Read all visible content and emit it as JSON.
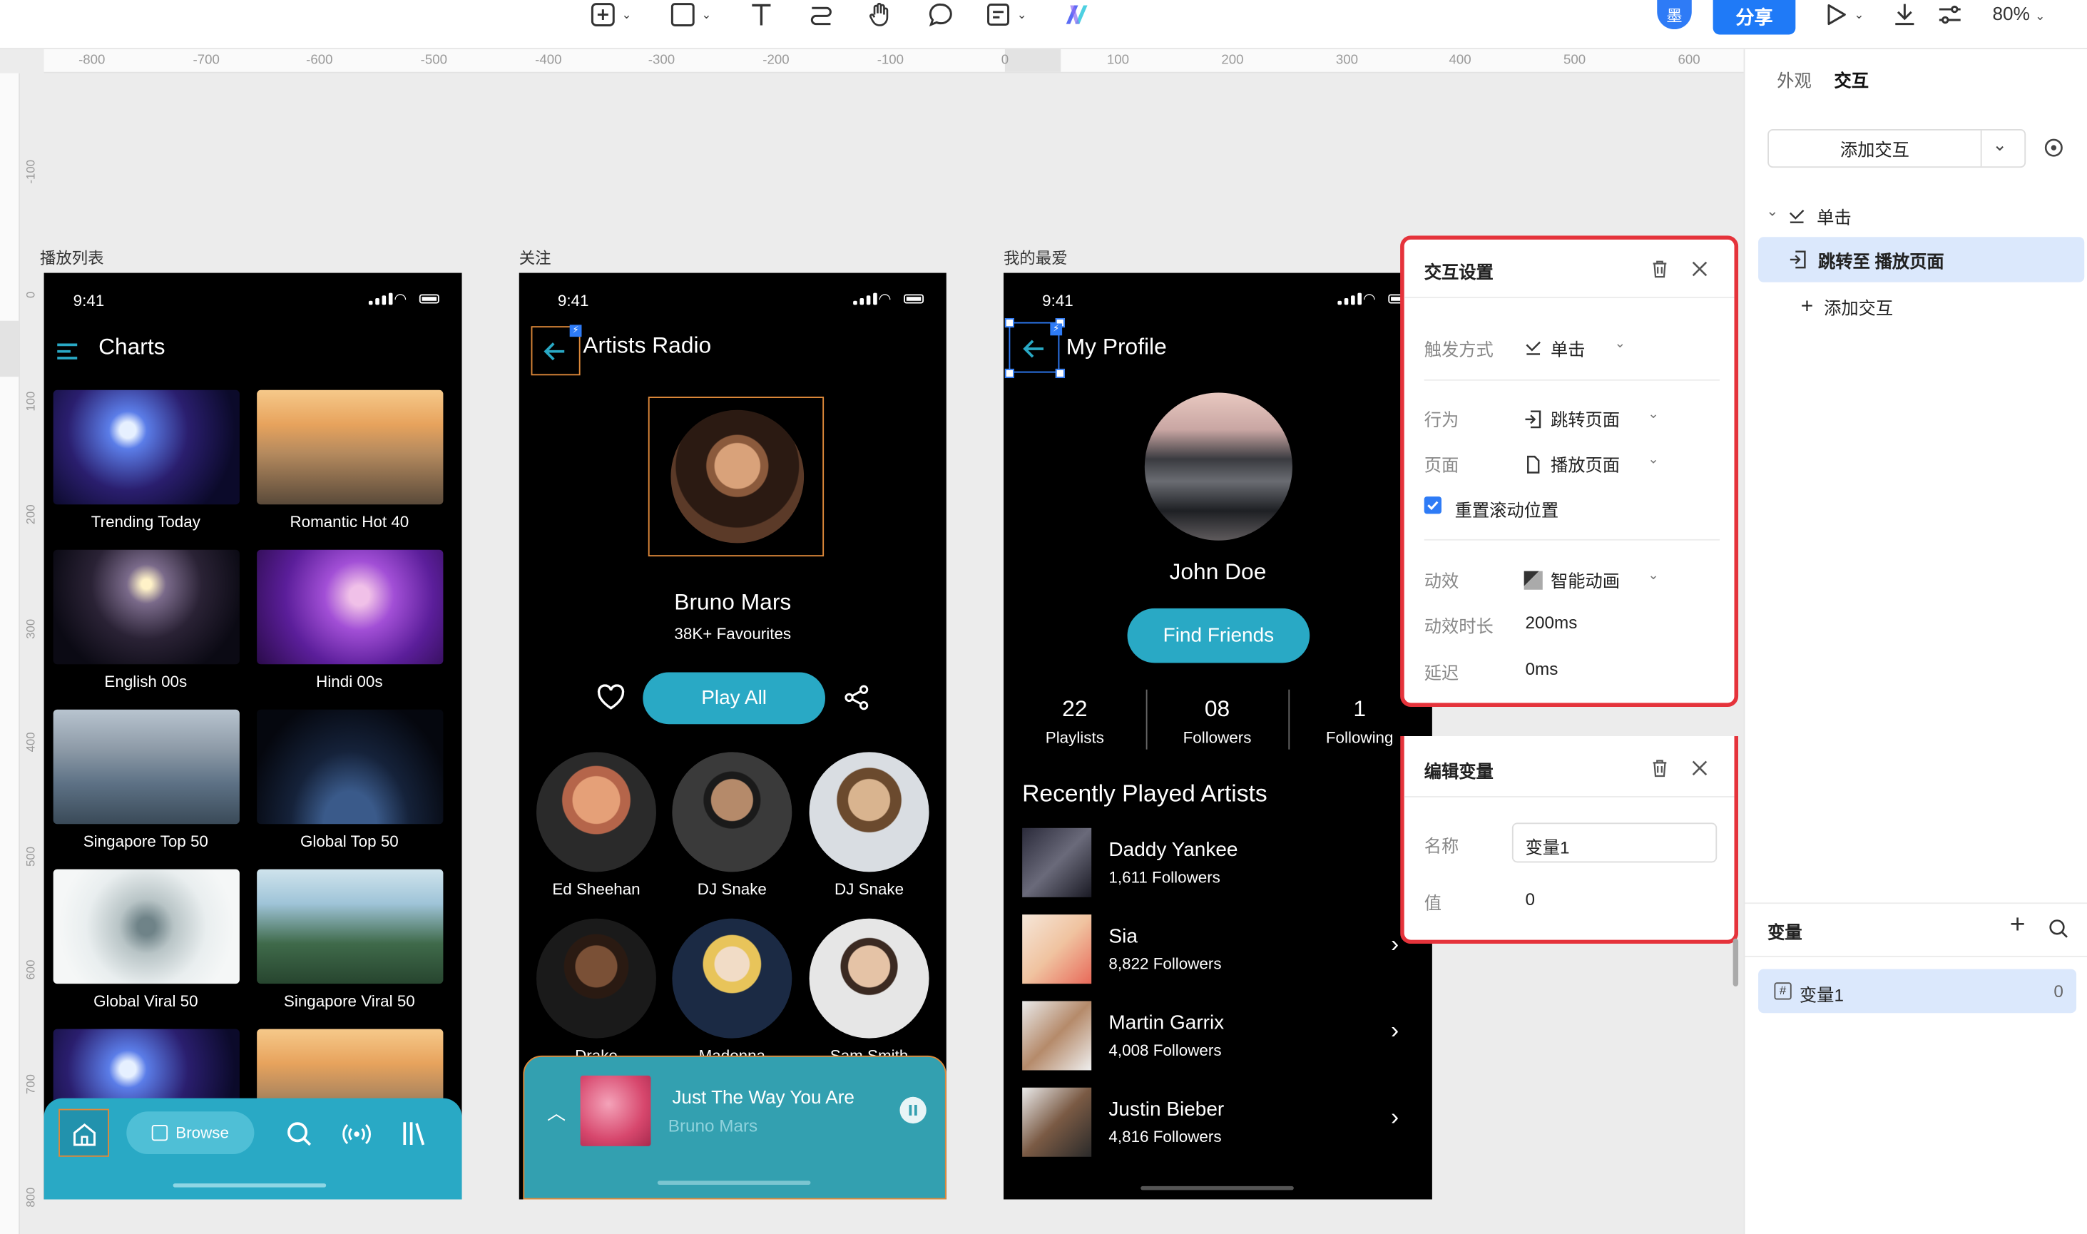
{
  "toolbar": {
    "tools": [
      "add-frame-icon",
      "rectangle-icon",
      "text-tool-icon",
      "connector-icon",
      "hand-tool-icon",
      "comment-icon",
      "note-icon",
      "ai-logo-icon"
    ],
    "avatar": "墨",
    "share_label": "分享",
    "zoom": "80%"
  },
  "ruler": {
    "h_ticks": [
      "-800",
      "-700",
      "-600",
      "-500",
      "-400",
      "-300",
      "-200",
      "-100",
      "0",
      "100",
      "200",
      "300",
      "400",
      "500",
      "600"
    ],
    "v_ticks": [
      "-100",
      "0",
      "100",
      "200",
      "300",
      "400",
      "500",
      "600",
      "700",
      "800"
    ]
  },
  "frames": {
    "playlist": {
      "label": "播放列表",
      "time": "9:41",
      "title": "Charts",
      "tiles": [
        {
          "caption": "Trending Today",
          "theme": "concert-blue"
        },
        {
          "caption": "Romantic Hot 40",
          "theme": "sunset-couple"
        },
        {
          "caption": "English 00s",
          "theme": "stage-lights"
        },
        {
          "caption": "Hindi 00s",
          "theme": "purple-guitarist"
        },
        {
          "caption": "Singapore Top 50",
          "theme": "city-aerial"
        },
        {
          "caption": "Global Top 50",
          "theme": "earth-night"
        },
        {
          "caption": "Global Viral 50",
          "theme": "fractal-white"
        },
        {
          "caption": "Singapore Viral 50",
          "theme": "gardens"
        },
        {
          "caption": "",
          "theme": "concert-blue"
        },
        {
          "caption": "",
          "theme": "sunset-couple"
        }
      ],
      "nav": {
        "browse_label": "Browse"
      }
    },
    "follow": {
      "label": "关注",
      "time": "9:41",
      "title": "Artists Radio",
      "artist_name": "Bruno Mars",
      "favourites": "38K+ Favourites",
      "play_all": "Play All",
      "artists": [
        "Ed Sheehan",
        "DJ Snake",
        "DJ Snake",
        "Drake",
        "Madonna",
        "Sam Smith"
      ],
      "now_playing": {
        "song": "Just The Way You Are",
        "artist": "Bruno Mars"
      }
    },
    "favorite": {
      "label": "我的最爱",
      "time": "9:41",
      "title": "My Profile",
      "user_name": "John Doe",
      "find_friends": "Find Friends",
      "stats": [
        {
          "value": "22",
          "label": "Playlists"
        },
        {
          "value": "08",
          "label": "Followers"
        },
        {
          "value": "1",
          "label": "Following"
        }
      ],
      "section_title": "Recently Played Artists",
      "recent": [
        {
          "name": "Daddy Yankee",
          "followers": "1,611 Followers"
        },
        {
          "name": "Sia",
          "followers": "8,822 Followers"
        },
        {
          "name": "Martin Garrix",
          "followers": "4,008 Followers"
        },
        {
          "name": "Justin Bieber",
          "followers": "4,816 Followers"
        }
      ]
    }
  },
  "interaction_panel": {
    "title": "交互设置",
    "trigger_label": "触发方式",
    "trigger_value": "单击",
    "action_label": "行为",
    "action_value": "跳转页面",
    "page_label": "页面",
    "page_value": "播放页面",
    "reset_scroll": "重置滚动位置",
    "reset_scroll_checked": true,
    "anim_label": "动效",
    "anim_value": "智能动画",
    "duration_label": "动效时长",
    "duration_value": "200ms",
    "delay_label": "延迟",
    "delay_value": "0ms"
  },
  "variable_panel": {
    "title": "编辑变量",
    "name_label": "名称",
    "name_value": "变量1",
    "value_label": "值",
    "value_value": "0"
  },
  "sidebar": {
    "tabs": [
      "外观",
      "交互"
    ],
    "active_tab": "交互",
    "add_interaction": "添加交互",
    "event": "单击",
    "action_item": "跳转至 播放页面",
    "add_interaction_link": "添加交互",
    "variables_title": "变量",
    "variables": [
      {
        "name": "变量1",
        "value": "0"
      }
    ]
  },
  "colors": {
    "accent_teal": "#29a9c5",
    "highlight_red": "#e5333b",
    "selection_blue": "#2e7bf6",
    "selected_row": "#dbe8fc"
  }
}
